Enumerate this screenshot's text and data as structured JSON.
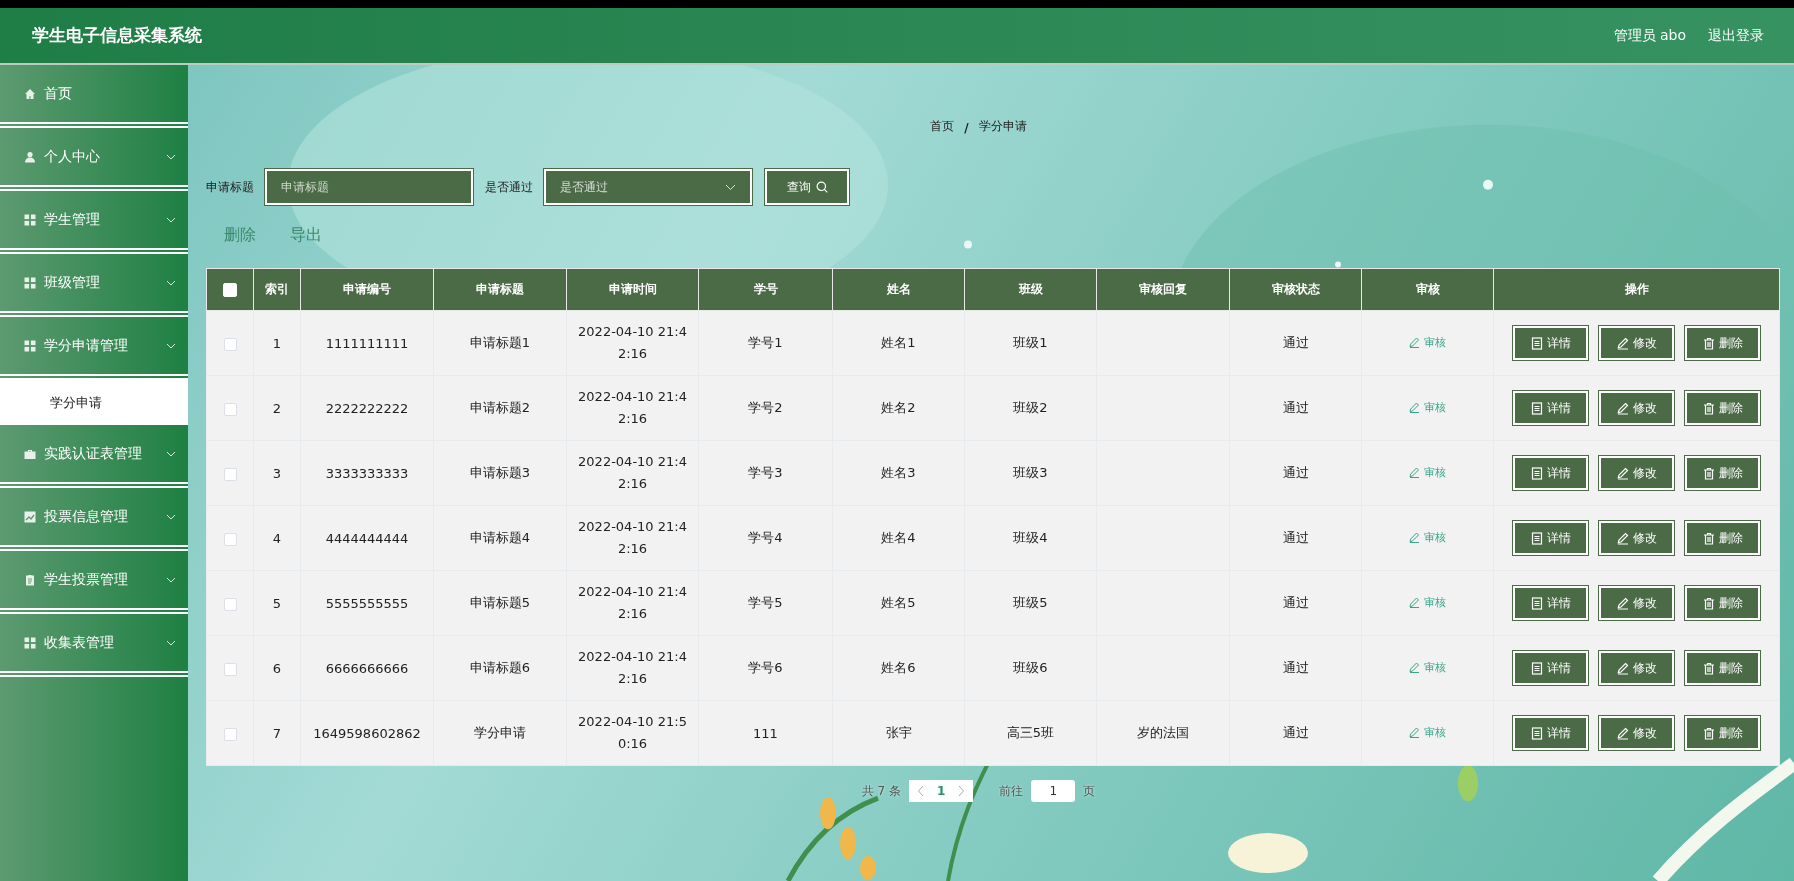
{
  "header": {
    "title": "学生电子信息采集系统",
    "user": "管理员 abo",
    "logout": "退出登录"
  },
  "sidebar": {
    "items": [
      {
        "label": "首页",
        "kind": "home"
      },
      {
        "label": "个人中心",
        "kind": "user"
      },
      {
        "label": "学生管理",
        "kind": "grid"
      },
      {
        "label": "班级管理",
        "kind": "grid"
      },
      {
        "label": "学分申请管理",
        "kind": "grid",
        "children": [
          {
            "label": "学分申请",
            "selected": true
          }
        ]
      },
      {
        "label": "实践认证表管理",
        "kind": "case"
      },
      {
        "label": "投票信息管理",
        "kind": "chart"
      },
      {
        "label": "学生投票管理",
        "kind": "clip"
      },
      {
        "label": "收集表管理",
        "kind": "grid"
      }
    ]
  },
  "breadcrumb": {
    "items": [
      "首页",
      "学分申请"
    ],
    "separator": "/"
  },
  "search": {
    "fields": [
      {
        "label": "申请标题",
        "placeholder": "申请标题",
        "kind": "input"
      },
      {
        "label": "是否通过",
        "placeholder": "是否通过",
        "kind": "select"
      }
    ],
    "button": "查询"
  },
  "actions": [
    "删除",
    "导出"
  ],
  "table": {
    "select_all": {
      "checked": false
    },
    "columns": [
      "索引",
      "申请编号",
      "申请标题",
      "申请时间",
      "学号",
      "姓名",
      "班级",
      "审核回复",
      "审核状态",
      "审核",
      "操作"
    ],
    "rows": [
      {
        "checked": false,
        "cells": [
          "1",
          "1111111111",
          "申请标题1",
          "2022-04-10 21:42:16",
          "学号1",
          "姓名1",
          "班级1",
          "",
          "通过"
        ],
        "review": "审核",
        "buttons": [
          "详情",
          "修改",
          "删除"
        ]
      },
      {
        "checked": false,
        "cells": [
          "2",
          "2222222222",
          "申请标题2",
          "2022-04-10 21:42:16",
          "学号2",
          "姓名2",
          "班级2",
          "",
          "通过"
        ],
        "review": "审核",
        "buttons": [
          "详情",
          "修改",
          "删除"
        ]
      },
      {
        "checked": false,
        "cells": [
          "3",
          "3333333333",
          "申请标题3",
          "2022-04-10 21:42:16",
          "学号3",
          "姓名3",
          "班级3",
          "",
          "通过"
        ],
        "review": "审核",
        "buttons": [
          "详情",
          "修改",
          "删除"
        ]
      },
      {
        "checked": false,
        "cells": [
          "4",
          "4444444444",
          "申请标题4",
          "2022-04-10 21:42:16",
          "学号4",
          "姓名4",
          "班级4",
          "",
          "通过"
        ],
        "review": "审核",
        "buttons": [
          "详情",
          "修改",
          "删除"
        ]
      },
      {
        "checked": false,
        "cells": [
          "5",
          "5555555555",
          "申请标题5",
          "2022-04-10 21:42:16",
          "学号5",
          "姓名5",
          "班级5",
          "",
          "通过"
        ],
        "review": "审核",
        "buttons": [
          "详情",
          "修改",
          "删除"
        ]
      },
      {
        "checked": false,
        "cells": [
          "6",
          "6666666666",
          "申请标题6",
          "2022-04-10 21:42:16",
          "学号6",
          "姓名6",
          "班级6",
          "",
          "通过"
        ],
        "review": "审核",
        "buttons": [
          "详情",
          "修改",
          "删除"
        ]
      },
      {
        "checked": false,
        "cells": [
          "7",
          "1649598602862",
          "学分申请",
          "2022-04-10 21:50:16",
          "111",
          "张宇",
          "高三5班",
          "岁的法国",
          "通过"
        ],
        "review": "审核",
        "buttons": [
          "详情",
          "修改",
          "删除"
        ]
      }
    ]
  },
  "pagination": {
    "total": "共 7 条",
    "pages": [
      {
        "label": "1",
        "selected": true
      }
    ],
    "goto": "前往",
    "goto_value": "1",
    "page_unit": "页"
  }
}
